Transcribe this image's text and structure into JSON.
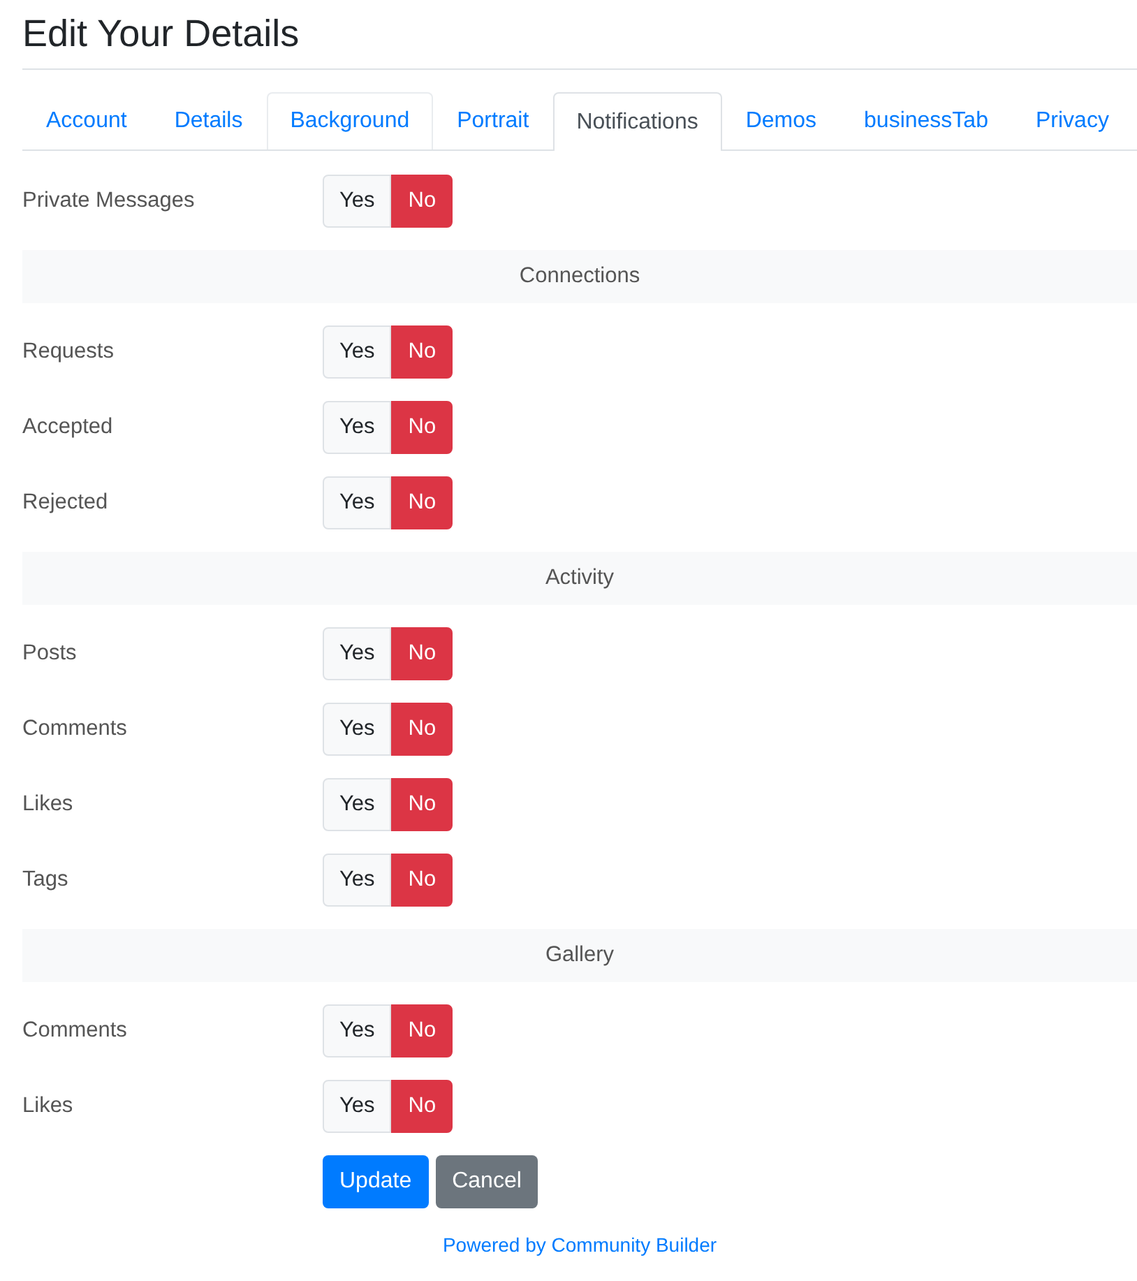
{
  "page": {
    "title": "Edit Your Details"
  },
  "tabs": [
    {
      "label": "Account",
      "selected": false,
      "hovered": false
    },
    {
      "label": "Details",
      "selected": false,
      "hovered": false
    },
    {
      "label": "Background",
      "selected": false,
      "hovered": true
    },
    {
      "label": "Portrait",
      "selected": false,
      "hovered": false
    },
    {
      "label": "Notifications",
      "selected": true,
      "hovered": false
    },
    {
      "label": "Demos",
      "selected": false,
      "hovered": false
    },
    {
      "label": "businessTab",
      "selected": false,
      "hovered": false
    },
    {
      "label": "Privacy",
      "selected": false,
      "hovered": false
    }
  ],
  "rows": [
    {
      "kind": "toggle",
      "label": "Private Messages",
      "options": [
        {
          "label": "Yes",
          "selected": false
        },
        {
          "label": "No",
          "selected": true
        }
      ]
    },
    {
      "kind": "heading",
      "label": "Connections"
    },
    {
      "kind": "toggle",
      "label": "Requests",
      "options": [
        {
          "label": "Yes",
          "selected": false
        },
        {
          "label": "No",
          "selected": true
        }
      ]
    },
    {
      "kind": "toggle",
      "label": "Accepted",
      "options": [
        {
          "label": "Yes",
          "selected": false
        },
        {
          "label": "No",
          "selected": true
        }
      ]
    },
    {
      "kind": "toggle",
      "label": "Rejected",
      "options": [
        {
          "label": "Yes",
          "selected": false
        },
        {
          "label": "No",
          "selected": true
        }
      ]
    },
    {
      "kind": "heading",
      "label": "Activity"
    },
    {
      "kind": "toggle",
      "label": "Posts",
      "options": [
        {
          "label": "Yes",
          "selected": false
        },
        {
          "label": "No",
          "selected": true
        }
      ]
    },
    {
      "kind": "toggle",
      "label": "Comments",
      "options": [
        {
          "label": "Yes",
          "selected": false
        },
        {
          "label": "No",
          "selected": true
        }
      ]
    },
    {
      "kind": "toggle",
      "label": "Likes",
      "options": [
        {
          "label": "Yes",
          "selected": false
        },
        {
          "label": "No",
          "selected": true
        }
      ]
    },
    {
      "kind": "toggle",
      "label": "Tags",
      "options": [
        {
          "label": "Yes",
          "selected": false
        },
        {
          "label": "No",
          "selected": true
        }
      ]
    },
    {
      "kind": "heading",
      "label": "Gallery"
    },
    {
      "kind": "toggle",
      "label": "Comments",
      "options": [
        {
          "label": "Yes",
          "selected": false
        },
        {
          "label": "No",
          "selected": true
        }
      ]
    },
    {
      "kind": "toggle",
      "label": "Likes",
      "options": [
        {
          "label": "Yes",
          "selected": false
        },
        {
          "label": "No",
          "selected": true
        }
      ]
    }
  ],
  "buttons": [
    {
      "label": "Update",
      "kind": "primary"
    },
    {
      "label": "Cancel",
      "kind": "secondary"
    }
  ],
  "footer": {
    "link": "Powered by Community Builder"
  }
}
